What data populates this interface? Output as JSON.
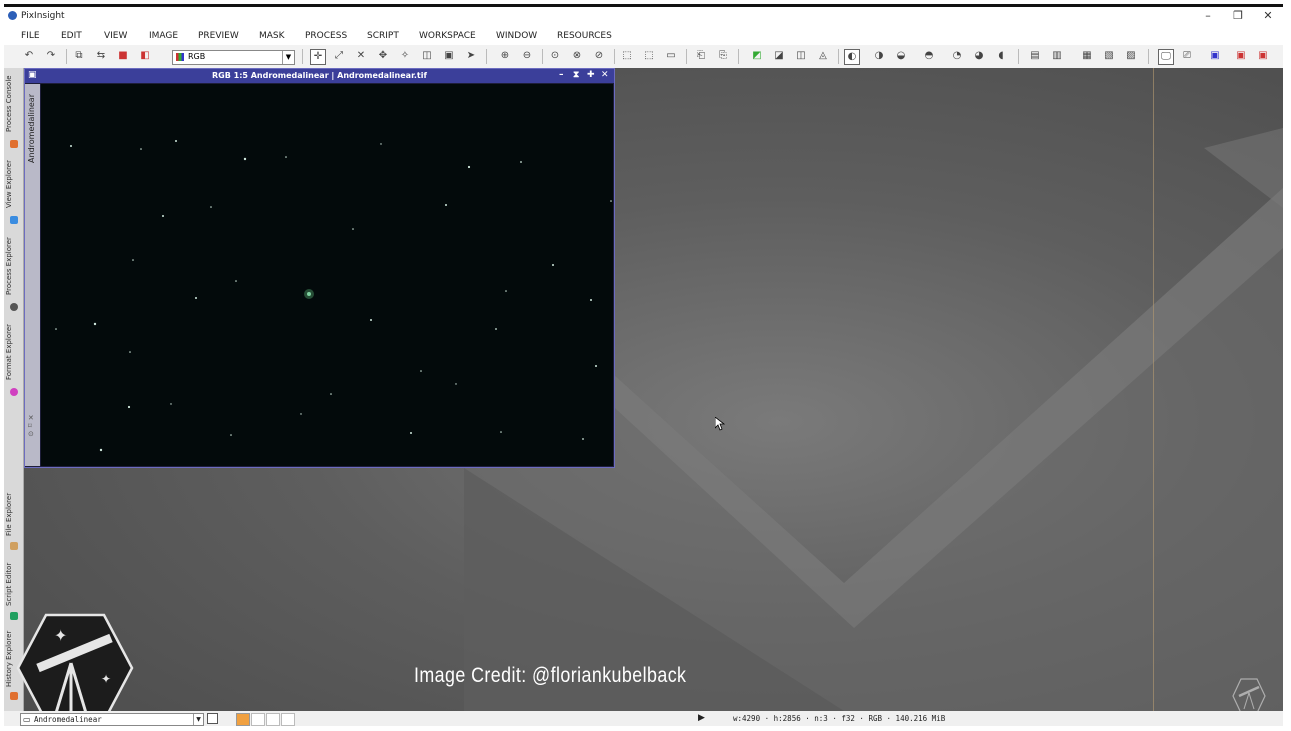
{
  "app": {
    "title": "PixInsight",
    "minimize": "–",
    "restore": "❐",
    "close": "✕"
  },
  "menu": [
    "FILE",
    "EDIT",
    "VIEW",
    "IMAGE",
    "PREVIEW",
    "MASK",
    "PROCESS",
    "SCRIPT",
    "WORKSPACE",
    "WINDOW",
    "RESOURCES"
  ],
  "toolbar": {
    "rgb_select": "RGB"
  },
  "sidebar": {
    "tabs": [
      "Process Console",
      "View Explorer",
      "Process Explorer",
      "Format Explorer",
      "File Explorer",
      "Script Editor",
      "History Explorer"
    ]
  },
  "image_window": {
    "title": "RGB 1:5 Andromedalinear | Andromedalinear.tif",
    "side_label": "Andromedalinear"
  },
  "statusbar": {
    "view_select": "Andromedalinear",
    "info": "w:4290 · h:2856 · n:3 · f32 · RGB · 140.216 MiB"
  },
  "overlay": {
    "credit": "Image Credit: @floriankubelback"
  },
  "colors": {
    "title_accent": "#3b3f9a",
    "workspace_bg": "#4a4a4a"
  }
}
